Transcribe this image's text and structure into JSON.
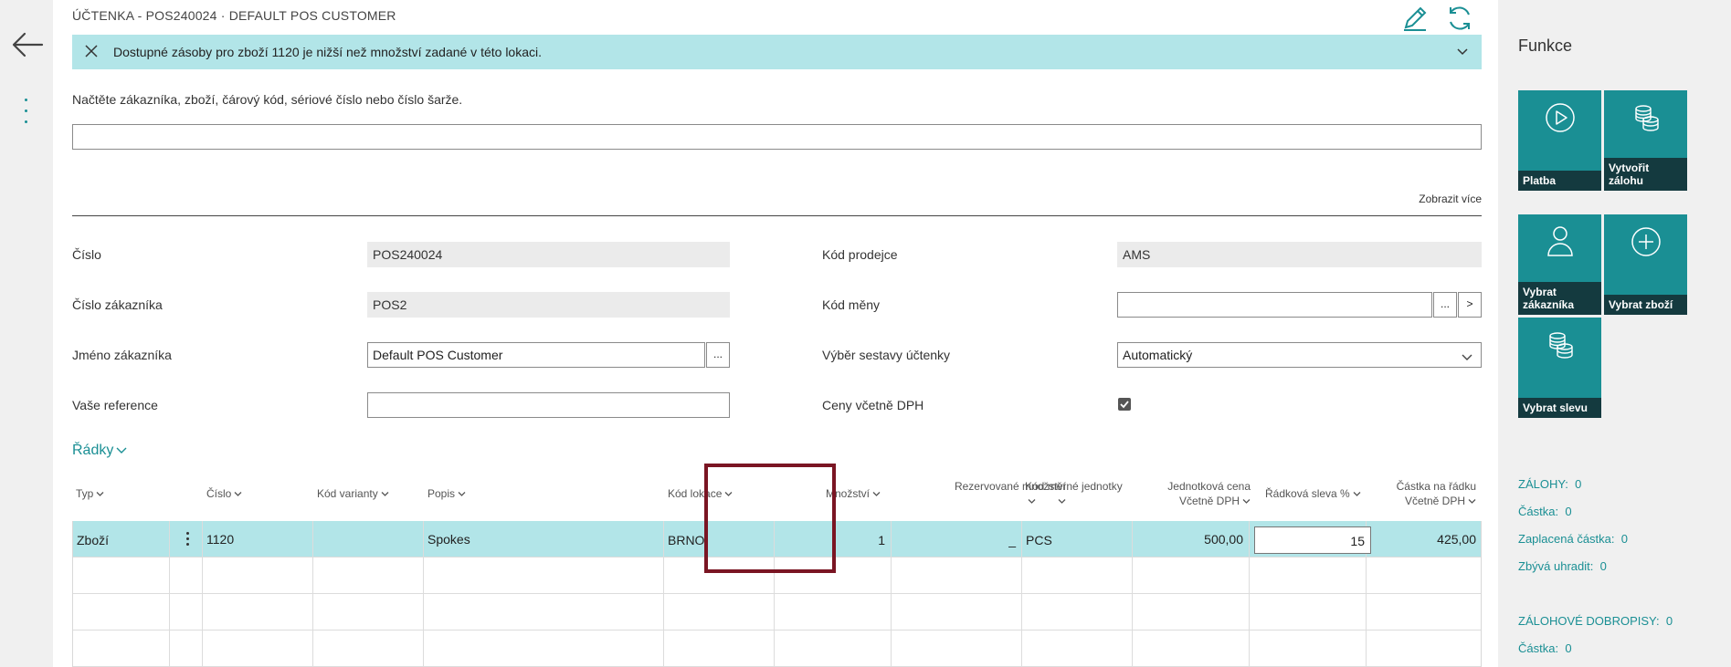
{
  "nav": {
    "back_icon": "arrow-left-icon",
    "more_icon": "vertical-ellipsis-icon"
  },
  "header": {
    "title": "ÚČTENKA - POS240024 · DEFAULT POS CUSTOMER",
    "edit_icon": "pencil-icon",
    "refresh_icon": "refresh-icon"
  },
  "notification": {
    "message": "Dostupné zásoby pro zboží 1120 je nižší než množství zadané v této lokaci."
  },
  "scan": {
    "label": "Načtěte zákazníka, zboží, čárový kód, sériové číslo nebo číslo šarže.",
    "value": ""
  },
  "show_more": "Zobrazit více",
  "fields": {
    "cislo": {
      "label": "Číslo",
      "value": "POS240024"
    },
    "cislo_zakaznika": {
      "label": "Číslo zákazníka",
      "value": "POS2"
    },
    "jmeno_zakaznika": {
      "label": "Jméno zákazníka",
      "value": "Default POS Customer"
    },
    "vase_reference": {
      "label": "Vaše reference",
      "value": ""
    },
    "kod_prodejce": {
      "label": "Kód prodejce",
      "value": "AMS"
    },
    "kod_meny": {
      "label": "Kód měny",
      "value": ""
    },
    "vyber_sestavy": {
      "label": "Výběr sestavy účtenky",
      "value": "Automatický"
    },
    "ceny_dph": {
      "label": "Ceny včetně DPH",
      "checked": true
    }
  },
  "buttons": {
    "lookup": "...",
    "next": ">"
  },
  "lines": {
    "title": "Řádky",
    "headers": {
      "typ": "Typ",
      "cislo": "Číslo",
      "kod_varianty": "Kód varianty",
      "popis": "Popis",
      "kod_lokace": "Kód lokace",
      "mnozstvi": "Množství",
      "rezervovane_1": "Rezervované množství",
      "kod_merne_1": "Kód měrné jednotky",
      "jednotkova_1": "Jednotková cena",
      "jednotkova_2": "Včetně DPH",
      "radkova_sleva": "Řádková sleva %",
      "castka_1": "Částka na řádku",
      "castka_2": "Včetně DPH"
    },
    "row": {
      "typ": "Zboží",
      "cislo": "1120",
      "kod_varianty": "",
      "popis": "Spokes",
      "kod_lokace": "BRNO",
      "mnozstvi": "1",
      "rezervovane": "_",
      "kod_merne": "PCS",
      "jednotkova_cena": "500,00",
      "radkova_sleva": "15",
      "castka": "425,00"
    }
  },
  "functions": {
    "title": "Funkce",
    "tiles": [
      {
        "label": "Platba",
        "icon": "play-circle-icon"
      },
      {
        "label": "Vytvořit zálohu",
        "icon": "coins-icon"
      },
      {
        "label": "Vybrat zákazníka",
        "icon": "person-icon"
      },
      {
        "label": "Vybrat zboží",
        "icon": "plus-circle-icon"
      },
      {
        "label": "Vybrat slevu",
        "icon": "coins-icon"
      }
    ],
    "stats": {
      "zalohy_label": "ZÁLOHY:",
      "zalohy_value": "0",
      "castka1_label": "Částka:",
      "castka1_value": "0",
      "zaplacena_label": "Zaplacená částka:",
      "zaplacena_value": "0",
      "zbyva_label": "Zbývá uhradit:",
      "zbyva_value": "0",
      "dobropisy_label": "ZÁLOHOVÉ DOBROPISY:",
      "dobropisy_value": "0",
      "castka2_label": "Částka:",
      "castka2_value": "0"
    }
  },
  "colors": {
    "accent": "#1a8f94",
    "notification_bg": "#b2e5e8",
    "tile_label_bg": "#143a3f",
    "highlight_border": "#7a1523"
  }
}
